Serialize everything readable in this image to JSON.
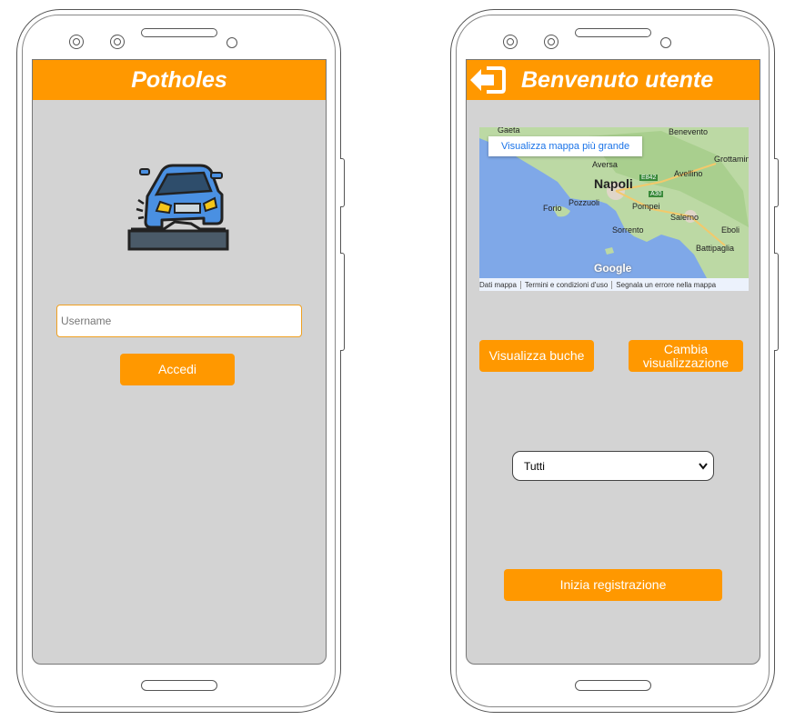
{
  "login_screen": {
    "title": "Potholes",
    "username_placeholder": "Username",
    "login_button": "Accedi",
    "logo": "car-pothole-icon"
  },
  "home_screen": {
    "title": "Benvenuto utente",
    "logout_icon": "logout-icon",
    "map": {
      "view_larger_link": "Visualizza mappa più grande",
      "places": {
        "gaeta": "Gaeta",
        "benevento": "Benevento",
        "aversa": "Aversa",
        "grottaminarda": "Grottamina",
        "napoli": "Napoli",
        "avellino": "Avellino",
        "pozzuoli": "Pozzuoli",
        "forio": "Forio",
        "pompei": "Pompei",
        "salerno": "Salerno",
        "sorrento": "Sorrento",
        "eboli": "Eboli",
        "battipaglia": "Battipaglia"
      },
      "road_labels": {
        "e842": "E842",
        "a30": "A30"
      },
      "google_logo": "Google",
      "footer": {
        "data": "Dati mappa",
        "terms": "Termini e condizioni d'uso",
        "report": "Segnala un errore nella mappa"
      }
    },
    "view_potholes_button": "Visualizza buche",
    "change_view_button": "Cambia visualizzazione",
    "filter_select": {
      "selected": "Tutti"
    },
    "start_recording_button": "Inizia registrazione"
  },
  "colors": {
    "accent": "#ff9800",
    "screen_bg": "#d3d3d3"
  }
}
